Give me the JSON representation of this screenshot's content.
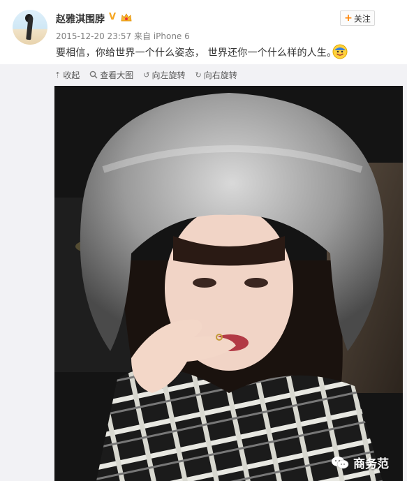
{
  "post": {
    "author_name": "赵雅淇围脖",
    "timestamp": "2015-12-20 23:57",
    "source_prefix": "来自",
    "source": "iPhone 6",
    "text": "要相信，你给世界一个什么姿态， 世界还你一个什么样的人生。",
    "emoji_icon": "smile-face-icon"
  },
  "follow_button": {
    "plus": "+",
    "label": "关注"
  },
  "toolbar": {
    "collapse_label": "收起",
    "view_large_label": "查看大图",
    "rotate_left_label": "向左旋转",
    "rotate_right_label": "向右旋转"
  },
  "photo": {
    "alt": "selfie-photo",
    "watermark": "商务范"
  },
  "colors": {
    "accent_orange": "#ff8200",
    "verified_gold": "#f5a623",
    "meta_gray": "#808080",
    "media_bg": "#f2f2f5"
  }
}
